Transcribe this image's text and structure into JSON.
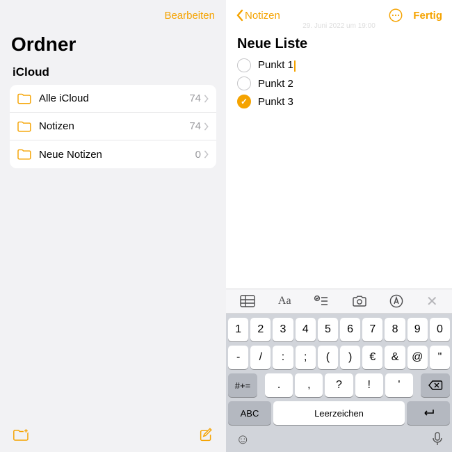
{
  "colors": {
    "accent": "#f5a300"
  },
  "left": {
    "edit": "Bearbeiten",
    "title": "Ordner",
    "section": "iCloud",
    "folders": [
      {
        "name": "Alle iCloud",
        "count": "74"
      },
      {
        "name": "Notizen",
        "count": "74"
      },
      {
        "name": "Neue Notizen",
        "count": "0"
      }
    ],
    "bottom": {
      "newFolder": "new-folder-icon",
      "compose": "compose-icon"
    }
  },
  "right": {
    "back": "Notizen",
    "ghostDate": "29. Juni 2022 um 19:00",
    "done": "Fertig",
    "note": {
      "title": "Neue Liste",
      "items": [
        {
          "label": "Punkt 1",
          "checked": false,
          "active": true
        },
        {
          "label": "Punkt 2",
          "checked": false,
          "active": false
        },
        {
          "label": "Punkt 3",
          "checked": true,
          "active": false
        }
      ]
    },
    "formatBar": {
      "table": "table-icon",
      "text": "Aa",
      "checklist": "checklist-icon",
      "camera": "camera-icon",
      "markup": "markup-icon",
      "close": "close-icon"
    },
    "keyboard": {
      "row1": [
        "1",
        "2",
        "3",
        "4",
        "5",
        "6",
        "7",
        "8",
        "9",
        "0"
      ],
      "row2": [
        "-",
        "/",
        ":",
        ";",
        "(",
        ")",
        "€",
        "&",
        "@",
        "\""
      ],
      "row3Mod": "#+=",
      "row3": [
        ".",
        ",",
        "?",
        "!",
        "'"
      ],
      "abc": "ABC",
      "space": "Leerzeichen",
      "emoji": "emoji-icon",
      "mic": "mic-icon",
      "backspace": "backspace-icon",
      "return": "return-icon"
    }
  }
}
